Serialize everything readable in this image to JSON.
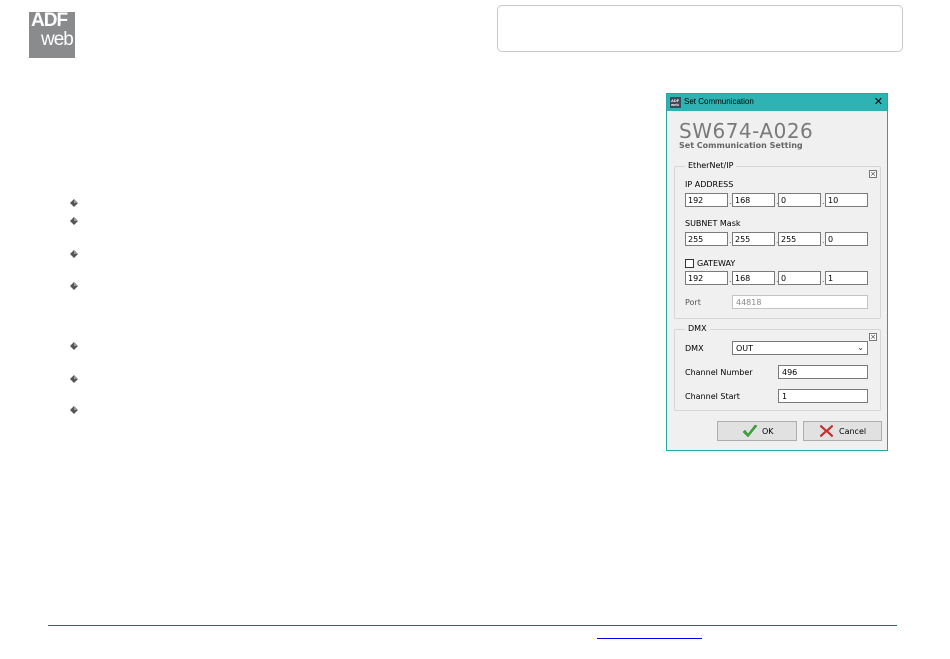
{
  "logo": {
    "line1": "ADF",
    "line2": "web"
  },
  "dialog": {
    "title": "Set Communication",
    "close_glyph": "✕",
    "product_code": "SW674-A026",
    "subtitle": "Set Communication Setting",
    "ethernet_group": {
      "label": "EtherNet/IP",
      "ip_address_label": "IP ADDRESS",
      "ip_address": [
        "192",
        "168",
        "0",
        "10"
      ],
      "subnet_label": "SUBNET Mask",
      "subnet": [
        "255",
        "255",
        "255",
        "0"
      ],
      "gateway_label": "GATEWAY",
      "gateway_checked": false,
      "gateway": [
        "192",
        "168",
        "0",
        "1"
      ],
      "port_label": "Port",
      "port_value": "44818",
      "ip_separator": "."
    },
    "dmx_group": {
      "label": "DMX",
      "dmx_label": "DMX",
      "dmx_value": "OUT",
      "channel_number_label": "Channel Number",
      "channel_number": "496",
      "channel_start_label": "Channel Start",
      "channel_start": "1"
    },
    "buttons": {
      "ok": "OK",
      "cancel": "Cancel"
    }
  },
  "colors": {
    "titlebar": "#2db3b3",
    "dialog_border": "#2aa3a3",
    "footer_line": "#1f6e6e",
    "link": "#0000ee",
    "logo_bg": "#8a8b8d"
  },
  "icons": {
    "bullet": "diamond-bullet-icon",
    "ok": "check-icon",
    "cancel": "red-x-icon",
    "group_collapse": "collapse-x-icon",
    "dropdown": "chevron-down-icon"
  }
}
